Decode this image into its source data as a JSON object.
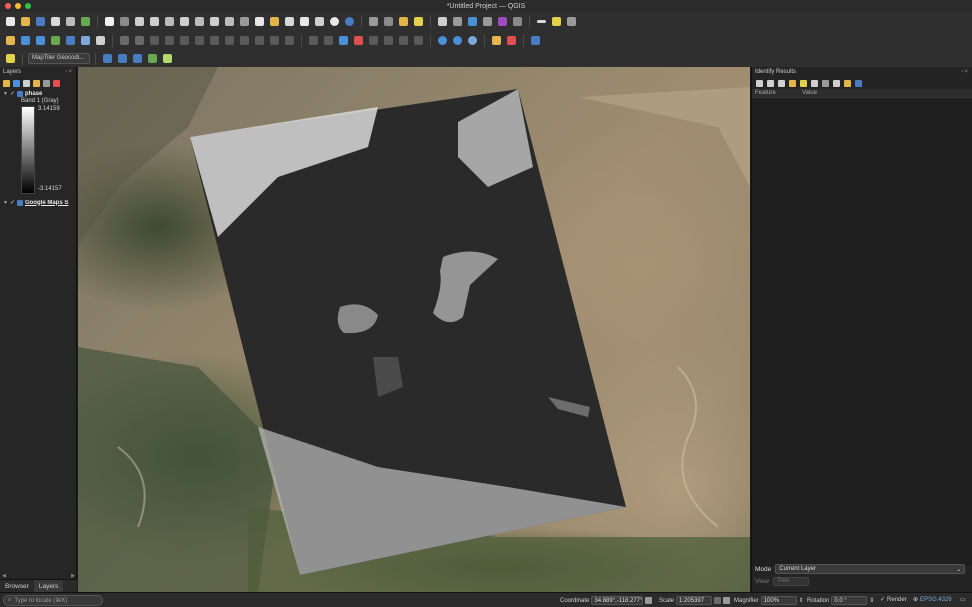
{
  "window": {
    "title": "*Untitled Project — QGIS"
  },
  "toolbar": {
    "locator_combo_label": "MapTiler Geocodi..."
  },
  "layers_panel": {
    "title": "Layers",
    "layers": [
      {
        "name": "phase",
        "band_label": "Band 1 (Gray)",
        "max_value": "3.14159",
        "min_value": "-3.14157",
        "checked": true
      },
      {
        "name": "Google Maps S",
        "checked": true
      }
    ],
    "tabs": [
      "Browser",
      "Layers"
    ],
    "active_tab": "Layers"
  },
  "identify_panel": {
    "title": "Identify Results",
    "columns": [
      "Feature",
      "Value"
    ],
    "mode_label": "Mode",
    "mode_value": "Current Layer",
    "view_label": "View",
    "view_value": "Tree"
  },
  "statusbar": {
    "locate_placeholder": "Type to locate (⌘K)",
    "coordinate_label": "Coordinate",
    "coordinate_value": "34.889°,-118.277°",
    "scale_label": "Scale",
    "scale_value": "1:205397",
    "magnifier_label": "Magnifier",
    "magnifier_value": "100%",
    "rotation_label": "Rotation",
    "rotation_value": "0.0 °",
    "render_label": "Render",
    "crs_label": "EPSG:4326"
  },
  "colors": {
    "accent": "#4a7cc2",
    "ui_background": "#2f2f2f"
  }
}
